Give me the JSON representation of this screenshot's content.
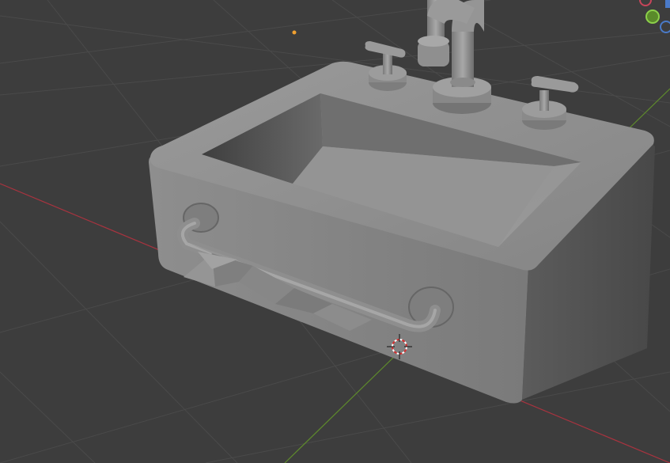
{
  "viewport": {
    "kind": "3d-viewport",
    "shading": "solid",
    "object": "sink",
    "colors": {
      "background": "#3d3d3d",
      "grid": "#4a4a4a",
      "x_axis": "#a8333f",
      "y_axis": "#5e8a2c",
      "model": "#8c8c8c",
      "origin_dot": "#f0a030"
    },
    "icons": {
      "cursor": "3d-cursor-icon",
      "gizmo_x": "gizmo-x-icon",
      "gizmo_y": "gizmo-y-icon",
      "gizmo_z": "gizmo-z-icon",
      "origin": "object-origin-icon"
    }
  }
}
